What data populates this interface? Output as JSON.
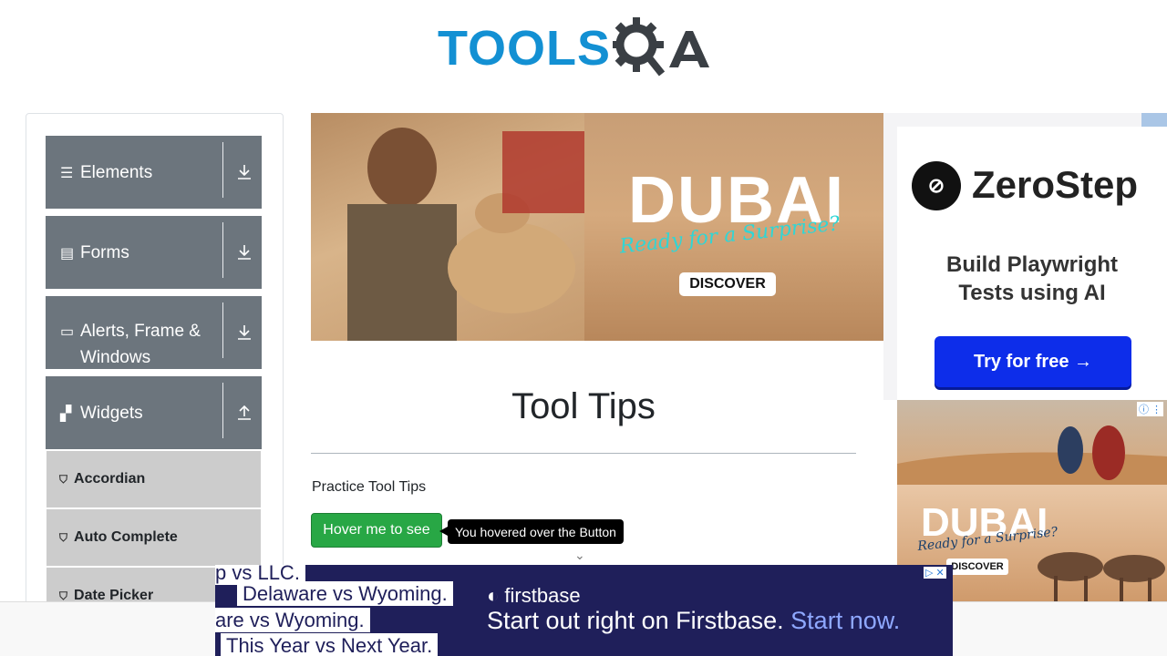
{
  "header": {
    "logo_tools": "TOOLS",
    "logo_qa": "QA"
  },
  "sidebar": {
    "groups": [
      {
        "label": "Elements",
        "icon": "hamburger-icon"
      },
      {
        "label": "Forms",
        "icon": "document-icon"
      },
      {
        "label": "Alerts, Frame & Windows",
        "icon": "window-icon"
      },
      {
        "label": "Widgets",
        "icon": "widgets-icon"
      }
    ],
    "widget_items": [
      "Accordian",
      "Auto Complete",
      "Date Picker"
    ]
  },
  "ad_top": {
    "headline": "DUBAI",
    "tagline": "Ready for a Surprise?",
    "cta": "DISCOVER"
  },
  "main": {
    "title": "Tool Tips",
    "practice_label": "Practice Tool Tips",
    "hover_button": "Hover me to see",
    "tooltip": "You hovered over the Button"
  },
  "ad_right": {
    "brand": "ZeroStep",
    "tagline_line1": "Build Playwright",
    "tagline_line2": "Tests using AI",
    "cta": "Try for free →"
  },
  "ad_right2": {
    "headline": "DUBAI",
    "tagline": "Ready for a Surprise?",
    "cta": "DISCOVER"
  },
  "ad_bottom": {
    "chips": [
      "p vs LLC.",
      "Delaware vs Wyoming.",
      "are vs Wyoming.",
      "This Year vs Next Year."
    ],
    "brand": "firstbase",
    "message": "Start out right on Firstbase.",
    "cta": "Start now."
  },
  "colors": {
    "accent": "#1390d3",
    "sidebar_group": "#6c757d",
    "button_green": "#28a745",
    "ad_blue": "#0d2dea"
  }
}
